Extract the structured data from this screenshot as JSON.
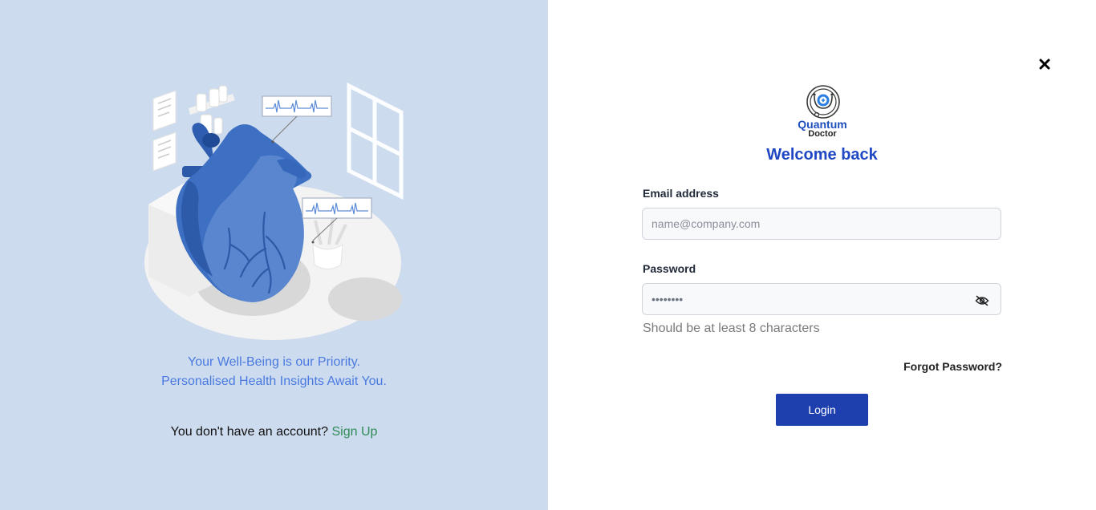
{
  "left_panel": {
    "tagline_line1": "Your Well-Being is our Priority.",
    "tagline_line2": "Personalised Health Insights Await You.",
    "signup_prompt": "You don't have an account?",
    "signup_link": "Sign Up"
  },
  "brand": {
    "name_line1": "Quantum",
    "name_line2": "Doctor"
  },
  "form": {
    "title": "Welcome back",
    "email_label": "Email address",
    "email_placeholder": "name@company.com",
    "email_value": "",
    "password_label": "Password",
    "password_value": "••••••••",
    "password_hint": "Should be at least 8 characters",
    "forgot_link": "Forgot Password?",
    "login_button": "Login"
  },
  "icons": {
    "close": "close-icon",
    "password_visibility": "eye-slash-icon",
    "logo": "stethoscope-logo-icon",
    "illustration": "heart-illustration"
  },
  "colors": {
    "left_background": "#cddbee",
    "accent_blue": "#1f47c4",
    "button_blue": "#1e40af",
    "tagline_blue": "#4a7ae0",
    "signup_green": "#2e8a56"
  }
}
